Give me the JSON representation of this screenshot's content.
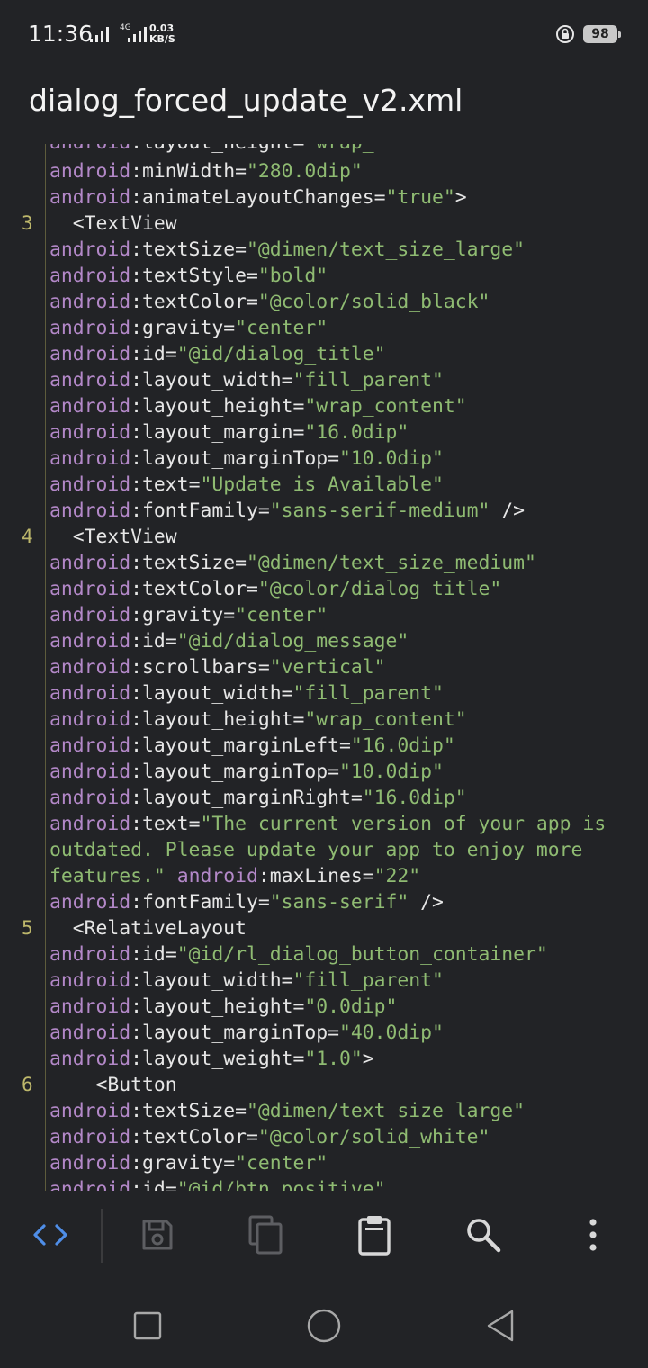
{
  "status": {
    "time": "11:36",
    "network_type": "4G",
    "speed_value": "0.03",
    "speed_unit": "KB/S",
    "battery": "98"
  },
  "header": {
    "file_title": "dialog_forced_update_v2.xml"
  },
  "editor": {
    "line_numbers": [
      "3",
      "4",
      "5",
      "6"
    ],
    "lines": [
      {
        "parts": [
          {
            "t": "android",
            "c": "ns"
          },
          {
            "t": ":",
            "c": "at"
          },
          {
            "t": "minWidth",
            "c": "at"
          },
          {
            "t": "=",
            "c": "at"
          },
          {
            "t": "\"280.0dip\"",
            "c": "val"
          }
        ]
      },
      {
        "parts": [
          {
            "t": "android",
            "c": "ns"
          },
          {
            "t": ":",
            "c": "at"
          },
          {
            "t": "animateLayoutChanges",
            "c": "at"
          },
          {
            "t": "=",
            "c": "at"
          },
          {
            "t": "\"true\"",
            "c": "val"
          },
          {
            "t": ">",
            "c": "tag"
          }
        ]
      },
      {
        "parts": [
          {
            "t": "  <TextView",
            "c": "tag"
          }
        ]
      },
      {
        "parts": [
          {
            "t": "android",
            "c": "ns"
          },
          {
            "t": ":",
            "c": "at"
          },
          {
            "t": "textSize",
            "c": "at"
          },
          {
            "t": "=",
            "c": "at"
          },
          {
            "t": "\"@dimen/text_size_large\"",
            "c": "val"
          }
        ]
      },
      {
        "parts": [
          {
            "t": "android",
            "c": "ns"
          },
          {
            "t": ":",
            "c": "at"
          },
          {
            "t": "textStyle",
            "c": "at"
          },
          {
            "t": "=",
            "c": "at"
          },
          {
            "t": "\"bold\"",
            "c": "val"
          }
        ]
      },
      {
        "parts": [
          {
            "t": "android",
            "c": "ns"
          },
          {
            "t": ":",
            "c": "at"
          },
          {
            "t": "textColor",
            "c": "at"
          },
          {
            "t": "=",
            "c": "at"
          },
          {
            "t": "\"@color/solid_black\"",
            "c": "val"
          }
        ]
      },
      {
        "parts": [
          {
            "t": "android",
            "c": "ns"
          },
          {
            "t": ":",
            "c": "at"
          },
          {
            "t": "gravity",
            "c": "at"
          },
          {
            "t": "=",
            "c": "at"
          },
          {
            "t": "\"center\"",
            "c": "val"
          }
        ]
      },
      {
        "parts": [
          {
            "t": "android",
            "c": "ns"
          },
          {
            "t": ":",
            "c": "at"
          },
          {
            "t": "id",
            "c": "at"
          },
          {
            "t": "=",
            "c": "at"
          },
          {
            "t": "\"@id/dialog_title\"",
            "c": "val"
          }
        ]
      },
      {
        "parts": [
          {
            "t": "android",
            "c": "ns"
          },
          {
            "t": ":",
            "c": "at"
          },
          {
            "t": "layout_width",
            "c": "at"
          },
          {
            "t": "=",
            "c": "at"
          },
          {
            "t": "\"fill_parent\"",
            "c": "val"
          }
        ]
      },
      {
        "parts": [
          {
            "t": "android",
            "c": "ns"
          },
          {
            "t": ":",
            "c": "at"
          },
          {
            "t": "layout_height",
            "c": "at"
          },
          {
            "t": "=",
            "c": "at"
          },
          {
            "t": "\"wrap_content\"",
            "c": "val"
          }
        ]
      },
      {
        "parts": [
          {
            "t": "android",
            "c": "ns"
          },
          {
            "t": ":",
            "c": "at"
          },
          {
            "t": "layout_margin",
            "c": "at"
          },
          {
            "t": "=",
            "c": "at"
          },
          {
            "t": "\"16.0dip\"",
            "c": "val"
          }
        ]
      },
      {
        "parts": [
          {
            "t": "android",
            "c": "ns"
          },
          {
            "t": ":",
            "c": "at"
          },
          {
            "t": "layout_marginTop",
            "c": "at"
          },
          {
            "t": "=",
            "c": "at"
          },
          {
            "t": "\"10.0dip\"",
            "c": "val"
          }
        ]
      },
      {
        "parts": [
          {
            "t": "android",
            "c": "ns"
          },
          {
            "t": ":",
            "c": "at"
          },
          {
            "t": "text",
            "c": "at"
          },
          {
            "t": "=",
            "c": "at"
          },
          {
            "t": "\"Update is Available\"",
            "c": "val"
          }
        ]
      },
      {
        "parts": [
          {
            "t": "android",
            "c": "ns"
          },
          {
            "t": ":",
            "c": "at"
          },
          {
            "t": "fontFamily",
            "c": "at"
          },
          {
            "t": "=",
            "c": "at"
          },
          {
            "t": "\"sans-serif-medium\"",
            "c": "val"
          },
          {
            "t": " />",
            "c": "tag"
          }
        ]
      },
      {
        "parts": [
          {
            "t": "  <TextView",
            "c": "tag"
          }
        ]
      },
      {
        "parts": [
          {
            "t": "android",
            "c": "ns"
          },
          {
            "t": ":",
            "c": "at"
          },
          {
            "t": "textSize",
            "c": "at"
          },
          {
            "t": "=",
            "c": "at"
          },
          {
            "t": "\"@dimen/text_size_medium\"",
            "c": "val"
          }
        ]
      },
      {
        "parts": [
          {
            "t": "android",
            "c": "ns"
          },
          {
            "t": ":",
            "c": "at"
          },
          {
            "t": "textColor",
            "c": "at"
          },
          {
            "t": "=",
            "c": "at"
          },
          {
            "t": "\"@color/dialog_title\"",
            "c": "val"
          }
        ]
      },
      {
        "parts": [
          {
            "t": "android",
            "c": "ns"
          },
          {
            "t": ":",
            "c": "at"
          },
          {
            "t": "gravity",
            "c": "at"
          },
          {
            "t": "=",
            "c": "at"
          },
          {
            "t": "\"center\"",
            "c": "val"
          }
        ]
      },
      {
        "parts": [
          {
            "t": "android",
            "c": "ns"
          },
          {
            "t": ":",
            "c": "at"
          },
          {
            "t": "id",
            "c": "at"
          },
          {
            "t": "=",
            "c": "at"
          },
          {
            "t": "\"@id/dialog_message\"",
            "c": "val"
          }
        ]
      },
      {
        "parts": [
          {
            "t": "android",
            "c": "ns"
          },
          {
            "t": ":",
            "c": "at"
          },
          {
            "t": "scrollbars",
            "c": "at"
          },
          {
            "t": "=",
            "c": "at"
          },
          {
            "t": "\"vertical\"",
            "c": "val"
          }
        ]
      },
      {
        "parts": [
          {
            "t": "android",
            "c": "ns"
          },
          {
            "t": ":",
            "c": "at"
          },
          {
            "t": "layout_width",
            "c": "at"
          },
          {
            "t": "=",
            "c": "at"
          },
          {
            "t": "\"fill_parent\"",
            "c": "val"
          }
        ]
      },
      {
        "parts": [
          {
            "t": "android",
            "c": "ns"
          },
          {
            "t": ":",
            "c": "at"
          },
          {
            "t": "layout_height",
            "c": "at"
          },
          {
            "t": "=",
            "c": "at"
          },
          {
            "t": "\"wrap_content\"",
            "c": "val"
          }
        ]
      },
      {
        "parts": [
          {
            "t": "android",
            "c": "ns"
          },
          {
            "t": ":",
            "c": "at"
          },
          {
            "t": "layout_marginLeft",
            "c": "at"
          },
          {
            "t": "=",
            "c": "at"
          },
          {
            "t": "\"16.0dip\"",
            "c": "val"
          }
        ]
      },
      {
        "parts": [
          {
            "t": "android",
            "c": "ns"
          },
          {
            "t": ":",
            "c": "at"
          },
          {
            "t": "layout_marginTop",
            "c": "at"
          },
          {
            "t": "=",
            "c": "at"
          },
          {
            "t": "\"10.0dip\"",
            "c": "val"
          }
        ]
      },
      {
        "parts": [
          {
            "t": "android",
            "c": "ns"
          },
          {
            "t": ":",
            "c": "at"
          },
          {
            "t": "layout_marginRight",
            "c": "at"
          },
          {
            "t": "=",
            "c": "at"
          },
          {
            "t": "\"16.0dip\"",
            "c": "val"
          }
        ]
      },
      {
        "parts": [
          {
            "t": "android",
            "c": "ns"
          },
          {
            "t": ":",
            "c": "at"
          },
          {
            "t": "text",
            "c": "at"
          },
          {
            "t": "=",
            "c": "at"
          },
          {
            "t": "\"The current version of your app is",
            "c": "val"
          }
        ]
      },
      {
        "parts": [
          {
            "t": "outdated. Please update your app to enjoy more",
            "c": "val"
          }
        ]
      },
      {
        "parts": [
          {
            "t": "features.\"",
            "c": "val"
          },
          {
            "t": " ",
            "c": "at"
          },
          {
            "t": "android",
            "c": "ns"
          },
          {
            "t": ":",
            "c": "at"
          },
          {
            "t": "maxLines",
            "c": "at"
          },
          {
            "t": "=",
            "c": "at"
          },
          {
            "t": "\"22\"",
            "c": "val"
          }
        ]
      },
      {
        "parts": [
          {
            "t": "android",
            "c": "ns"
          },
          {
            "t": ":",
            "c": "at"
          },
          {
            "t": "fontFamily",
            "c": "at"
          },
          {
            "t": "=",
            "c": "at"
          },
          {
            "t": "\"sans-serif\"",
            "c": "val"
          },
          {
            "t": " />",
            "c": "tag"
          }
        ]
      },
      {
        "parts": [
          {
            "t": "  <RelativeLayout",
            "c": "tag"
          }
        ]
      },
      {
        "parts": [
          {
            "t": "android",
            "c": "ns"
          },
          {
            "t": ":",
            "c": "at"
          },
          {
            "t": "id",
            "c": "at"
          },
          {
            "t": "=",
            "c": "at"
          },
          {
            "t": "\"@id/rl_dialog_button_container\"",
            "c": "val"
          }
        ]
      },
      {
        "parts": [
          {
            "t": "android",
            "c": "ns"
          },
          {
            "t": ":",
            "c": "at"
          },
          {
            "t": "layout_width",
            "c": "at"
          },
          {
            "t": "=",
            "c": "at"
          },
          {
            "t": "\"fill_parent\"",
            "c": "val"
          }
        ]
      },
      {
        "parts": [
          {
            "t": "android",
            "c": "ns"
          },
          {
            "t": ":",
            "c": "at"
          },
          {
            "t": "layout_height",
            "c": "at"
          },
          {
            "t": "=",
            "c": "at"
          },
          {
            "t": "\"0.0dip\"",
            "c": "val"
          }
        ]
      },
      {
        "parts": [
          {
            "t": "android",
            "c": "ns"
          },
          {
            "t": ":",
            "c": "at"
          },
          {
            "t": "layout_marginTop",
            "c": "at"
          },
          {
            "t": "=",
            "c": "at"
          },
          {
            "t": "\"40.0dip\"",
            "c": "val"
          }
        ]
      },
      {
        "parts": [
          {
            "t": "android",
            "c": "ns"
          },
          {
            "t": ":",
            "c": "at"
          },
          {
            "t": "layout_weight",
            "c": "at"
          },
          {
            "t": "=",
            "c": "at"
          },
          {
            "t": "\"1.0\"",
            "c": "val"
          },
          {
            "t": ">",
            "c": "tag"
          }
        ]
      },
      {
        "parts": [
          {
            "t": "    <Button",
            "c": "tag"
          }
        ]
      },
      {
        "parts": [
          {
            "t": "android",
            "c": "ns"
          },
          {
            "t": ":",
            "c": "at"
          },
          {
            "t": "textSize",
            "c": "at"
          },
          {
            "t": "=",
            "c": "at"
          },
          {
            "t": "\"@dimen/text_size_large\"",
            "c": "val"
          }
        ]
      },
      {
        "parts": [
          {
            "t": "android",
            "c": "ns"
          },
          {
            "t": ":",
            "c": "at"
          },
          {
            "t": "textColor",
            "c": "at"
          },
          {
            "t": "=",
            "c": "at"
          },
          {
            "t": "\"@color/solid_white\"",
            "c": "val"
          }
        ]
      },
      {
        "parts": [
          {
            "t": "android",
            "c": "ns"
          },
          {
            "t": ":",
            "c": "at"
          },
          {
            "t": "gravity",
            "c": "at"
          },
          {
            "t": "=",
            "c": "at"
          },
          {
            "t": "\"center\"",
            "c": "val"
          }
        ]
      },
      {
        "parts": [
          {
            "t": "android",
            "c": "ns"
          },
          {
            "t": ":",
            "c": "at"
          },
          {
            "t": "id",
            "c": "at"
          },
          {
            "t": "=",
            "c": "at"
          },
          {
            "t": "\"@id/btn_positive\"",
            "c": "val"
          }
        ]
      }
    ]
  },
  "toolbar": {
    "icons": [
      "code-icon",
      "save-icon",
      "copy-icon",
      "clipboard-icon",
      "search-icon",
      "more-vert-icon"
    ],
    "accent": "#4f8ee8"
  }
}
